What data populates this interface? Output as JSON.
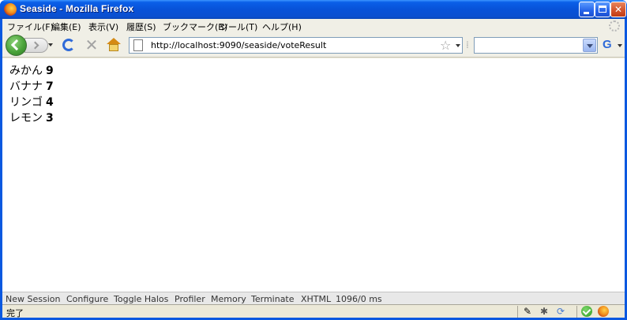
{
  "window": {
    "title": "Seaside - Mozilla Firefox"
  },
  "menubar": {
    "items": [
      {
        "label": "ファイル(F)"
      },
      {
        "label": "編集(E)"
      },
      {
        "label": "表示(V)"
      },
      {
        "label": "履歴(S)"
      },
      {
        "label": "ブックマーク(B)"
      },
      {
        "label": "ツール(T)"
      },
      {
        "label": "ヘルプ(H)"
      }
    ]
  },
  "navbar": {
    "url": "http://localhost:9090/seaside/voteResult",
    "search_value": "",
    "search_engine": "G"
  },
  "results": [
    {
      "name": "みかん",
      "count": "9"
    },
    {
      "name": "バナナ",
      "count": "7"
    },
    {
      "name": "リンゴ",
      "count": "4"
    },
    {
      "name": "レモン",
      "count": "3"
    }
  ],
  "seaside_toolbar": {
    "items": [
      {
        "label": "New Session"
      },
      {
        "label": "Configure"
      },
      {
        "label": "Toggle Halos"
      },
      {
        "label": "Profiler"
      },
      {
        "label": "Memory"
      },
      {
        "label": "Terminate"
      },
      {
        "label": "XHTML"
      },
      {
        "label": "1096/0 ms"
      }
    ]
  },
  "statusbar": {
    "text": "完了"
  },
  "colors": {
    "titlebar": "#0a58e0",
    "content_bg": "#ffffff",
    "seaside_bar_bg": "#e8e8e8"
  }
}
